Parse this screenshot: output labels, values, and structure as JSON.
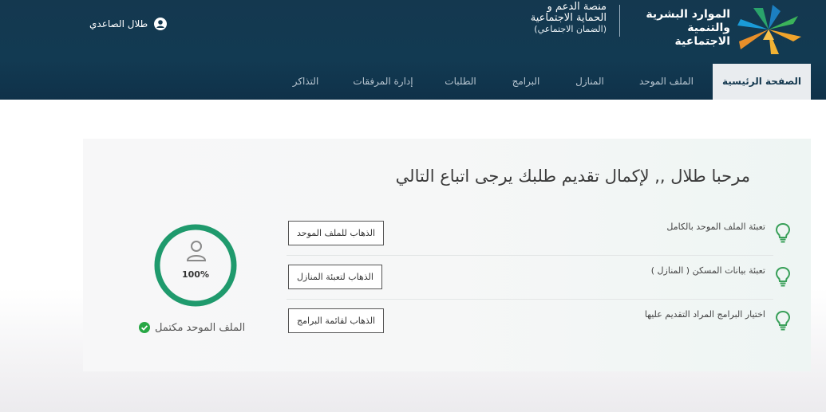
{
  "header": {
    "ministry_name_line1": "الموارد البشرية",
    "ministry_name_line2": "والتنمية الاجتماعية",
    "platform_line1": "منصة الدعم و",
    "platform_line2": "الحماية الاجتماعية",
    "platform_line3": "(الضمان الاجتماعي)",
    "user_name": "طلال الصاعدي"
  },
  "nav": {
    "items": [
      {
        "label": "الصفحة الرئيسية"
      },
      {
        "label": "الملف الموحد"
      },
      {
        "label": "المنازل"
      },
      {
        "label": "البرامج"
      },
      {
        "label": "الطلبات"
      },
      {
        "label": "إدارة المرفقات"
      },
      {
        "label": "التذاكر"
      }
    ]
  },
  "main": {
    "welcome": "مرحبا طلال ,, لإكمال تقديم طلبك يرجى اتباع التالي",
    "steps": [
      {
        "text": "تعبئة الملف الموحد بالكامل",
        "button": "الذهاب للملف الموحد"
      },
      {
        "text": "تعبئة بيانات المسكن ( المنازل )",
        "button": "الذهاب لتعبئة المنازل"
      },
      {
        "text": "اختيار البرامج المراد التقديم عليها",
        "button": "الذهاب لقائمة البرامج"
      }
    ],
    "progress_label": "100%",
    "progress": 1.0,
    "complete_label": "الملف الموحد مكتمل"
  },
  "colors": {
    "header_bg": "#14384f",
    "accent_green": "#1f9a6d",
    "bulb_green": "#3aa05a",
    "check_green": "#28a745"
  }
}
